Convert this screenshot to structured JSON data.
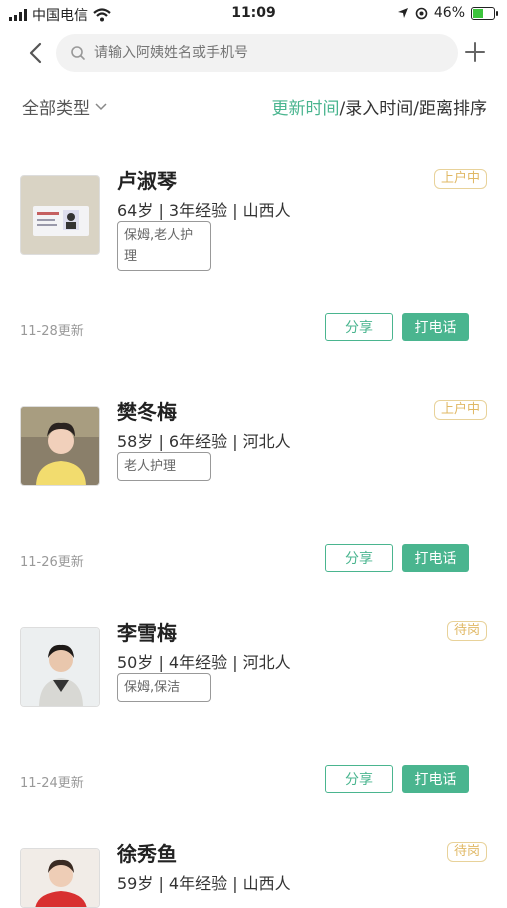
{
  "status_bar": {
    "carrier": "中国电信",
    "time": "11:09",
    "battery": "46%"
  },
  "search": {
    "placeholder": "请输入阿姨姓名或手机号"
  },
  "filter": {
    "type_label": "全部类型",
    "sort_update": "更新时间",
    "sort_entry": "/录入时间",
    "sort_distance": "/距离排序"
  },
  "workers": [
    {
      "name": "卢淑琴",
      "info": "64岁 | 3年经验 | 山西人",
      "tags": "保姆,老人护理",
      "status": "上户中",
      "updated": "11-28更新",
      "share": "分享",
      "call": "打电话"
    },
    {
      "name": "樊冬梅",
      "info": "58岁 | 6年经验 | 河北人",
      "tags": "老人护理",
      "status": "上户中",
      "updated": "11-26更新",
      "share": "分享",
      "call": "打电话"
    },
    {
      "name": "李雪梅",
      "info": "50岁 | 4年经验 | 河北人",
      "tags": "保姆,保洁",
      "status": "待岗",
      "updated": "11-24更新",
      "share": "分享",
      "call": "打电话"
    },
    {
      "name": "徐秀鱼",
      "info": "59岁 | 4年经验 | 山西人",
      "status": "待岗"
    }
  ]
}
